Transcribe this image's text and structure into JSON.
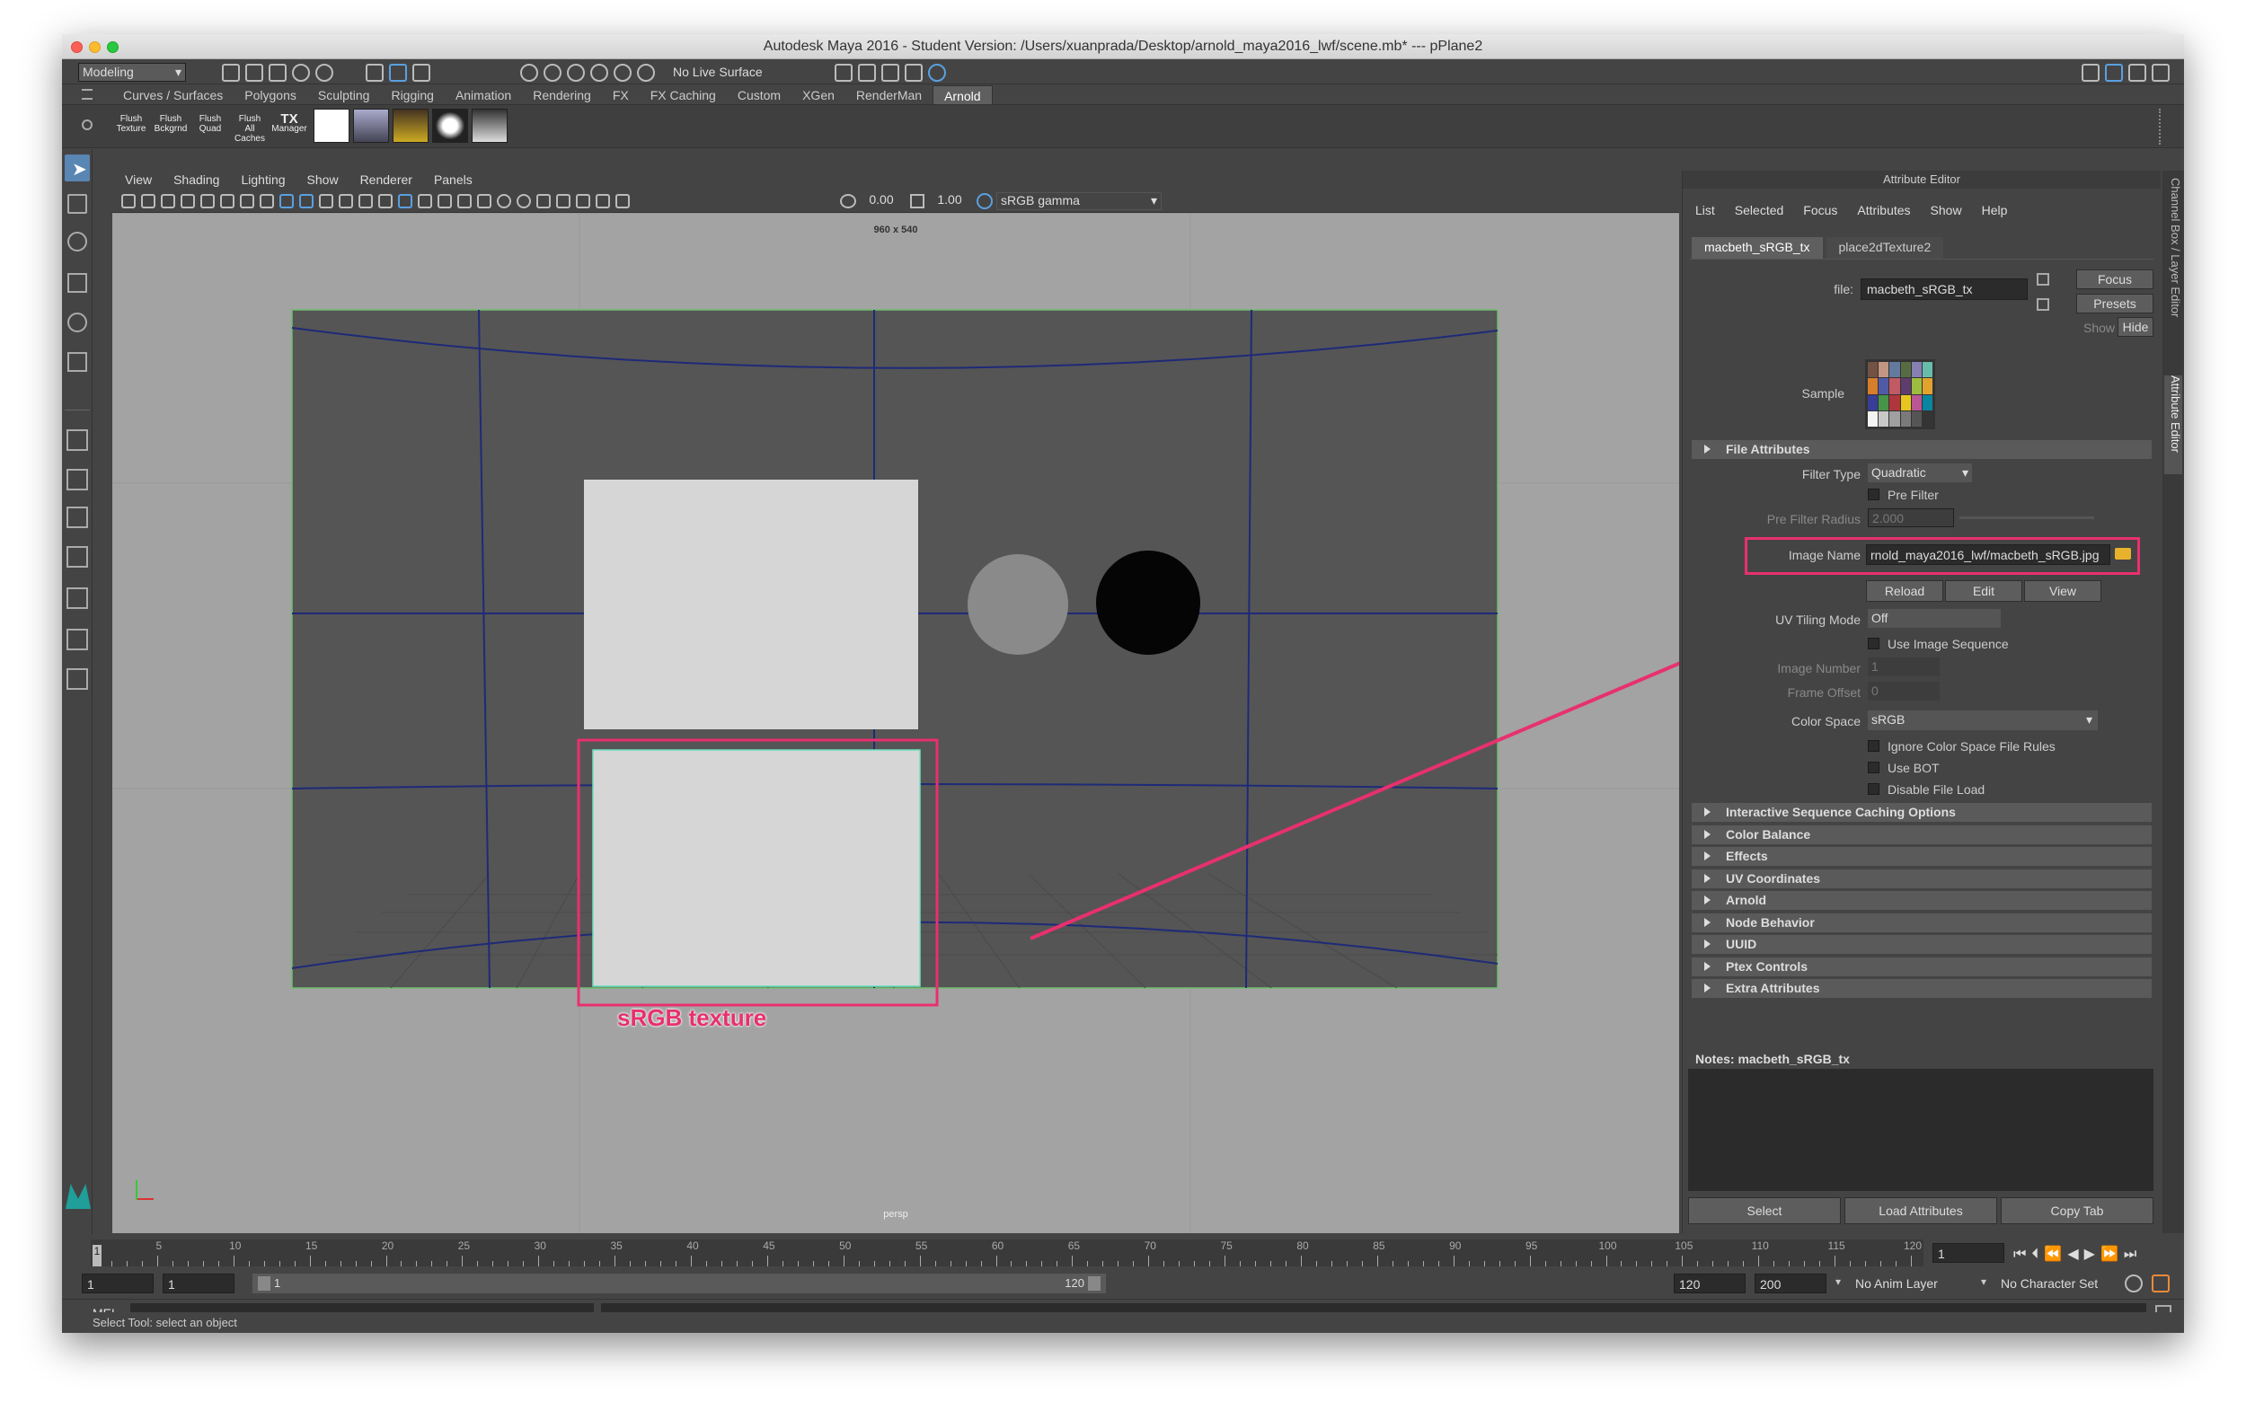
{
  "window": {
    "title": "Autodesk Maya 2016 - Student Version: /Users/xuanprada/Desktop/arnold_maya2016_lwf/scene.mb* --- pPlane2"
  },
  "toolbar": {
    "mode": "Modeling",
    "live_surface": "No Live Surface"
  },
  "shelf": {
    "tabs": [
      "Curves / Surfaces",
      "Polygons",
      "Sculpting",
      "Rigging",
      "Animation",
      "Rendering",
      "FX",
      "FX Caching",
      "Custom",
      "XGen",
      "RenderMan",
      "Arnold"
    ],
    "active_tab": "Arnold",
    "buttons": [
      {
        "l1": "Flush",
        "l2": "Texture"
      },
      {
        "l1": "Flush",
        "l2": "Bckgrnd"
      },
      {
        "l1": "Flush",
        "l2": "Quad"
      },
      {
        "l1": "Flush",
        "l2": "All Caches"
      },
      {
        "l1": "TX",
        "l2": "Manager"
      }
    ]
  },
  "viewport": {
    "menu": [
      "View",
      "Shading",
      "Lighting",
      "Show",
      "Renderer",
      "Panels"
    ],
    "exposure": "0.00",
    "gamma": "1.00",
    "color_view": "sRGB gamma",
    "resolution": "960 x 540",
    "camera": "persp",
    "annotation": "sRGB texture",
    "annotation_color": "#e8306f"
  },
  "attr_editor": {
    "title": "Attribute Editor",
    "menu": [
      "List",
      "Selected",
      "Focus",
      "Attributes",
      "Show",
      "Help"
    ],
    "tabs": [
      "macbeth_sRGB_tx",
      "place2dTexture2"
    ],
    "side_tabs": [
      "Channel Box / Layer Editor",
      "Attribute Editor"
    ],
    "file_label": "file:",
    "file_value": "macbeth_sRGB_tx",
    "focus_label": "Focus",
    "presets_label": "Presets",
    "show_label": "Show",
    "hide_label": "Hide",
    "sample_label": "Sample",
    "file_attributes": "File Attributes",
    "filter_type_label": "Filter Type",
    "filter_type": "Quadratic",
    "pre_filter": "Pre Filter",
    "pre_filter_radius_label": "Pre Filter Radius",
    "pre_filter_radius": "2.000",
    "image_name_label": "Image Name",
    "image_name": "rnold_maya2016_lwf/macbeth_sRGB.jpg",
    "reload": "Reload",
    "edit": "Edit",
    "view": "View",
    "uv_tiling_label": "UV Tiling Mode",
    "uv_tiling": "Off",
    "use_image_seq": "Use Image Sequence",
    "image_number_label": "Image Number",
    "image_number": "1",
    "frame_offset_label": "Frame Offset",
    "frame_offset": "0",
    "color_space_label": "Color Space",
    "color_space": "sRGB",
    "ignore_cs": "Ignore Color Space File Rules",
    "use_bot": "Use BOT",
    "disable_load": "Disable File Load",
    "sections": [
      "Interactive Sequence Caching Options",
      "Color Balance",
      "Effects",
      "UV Coordinates",
      "Arnold",
      "Node Behavior",
      "UUID",
      "Ptex Controls",
      "Extra Attributes"
    ],
    "notes": "Notes:  macbeth_sRGB_tx",
    "bottom": [
      "Select",
      "Load Attributes",
      "Copy Tab"
    ]
  },
  "timeline": {
    "ticks": [
      "5",
      "10",
      "15",
      "20",
      "25",
      "30",
      "35",
      "40",
      "45",
      "50",
      "55",
      "60",
      "65",
      "70",
      "75",
      "80",
      "85",
      "90",
      "95",
      "100",
      "105",
      "110",
      "115",
      "120"
    ],
    "current": "1",
    "current_frame": "1",
    "range_start": "1",
    "range_start2": "1",
    "slider_start": "1",
    "slider_end": "120",
    "range_end": "120",
    "range_end2": "200",
    "anim_layer": "No Anim Layer",
    "char_set": "No Character Set"
  },
  "cmdline": {
    "lang": "MEL"
  },
  "status": {
    "help": "Select Tool: select an object"
  }
}
